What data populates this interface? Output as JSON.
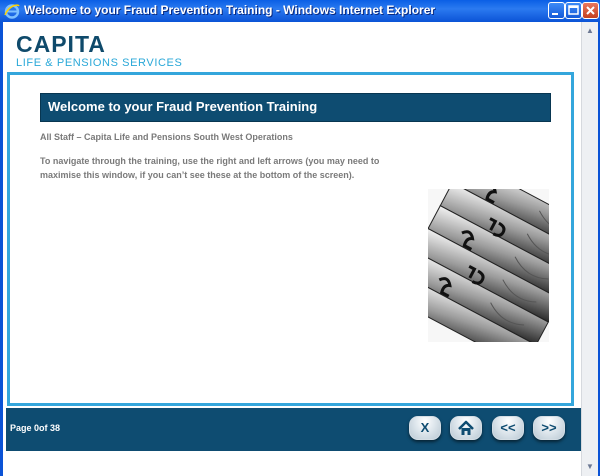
{
  "window": {
    "title": "Welcome to your Fraud Prevention Training - Windows Internet Explorer",
    "icon": "ie-icon",
    "controls": {
      "minimize": "minimize-icon",
      "maximize": "maximize-icon",
      "close": "close-icon"
    }
  },
  "logo": {
    "main": "CAPITA",
    "sub": "LIFE & PENSIONS SERVICES"
  },
  "content": {
    "heading": "Welcome to your Fraud Prevention Training",
    "subtitle": "All Staff – Capita Life and Pensions South West Operations",
    "instructions": "To navigate through the training, use the right and left arrows (you may need to maximise this window, if you can’t  see these at the bottom of the screen).",
    "image": "banknotes-photo"
  },
  "nav": {
    "page_label": "Page 0of 38",
    "buttons": {
      "exit": "X",
      "home": "home-icon",
      "prev": "<<",
      "next": ">>"
    }
  },
  "colors": {
    "brand_dark": "#0e4c71",
    "brand_light": "#34a6dc",
    "text_grey": "#7a7a7a"
  }
}
